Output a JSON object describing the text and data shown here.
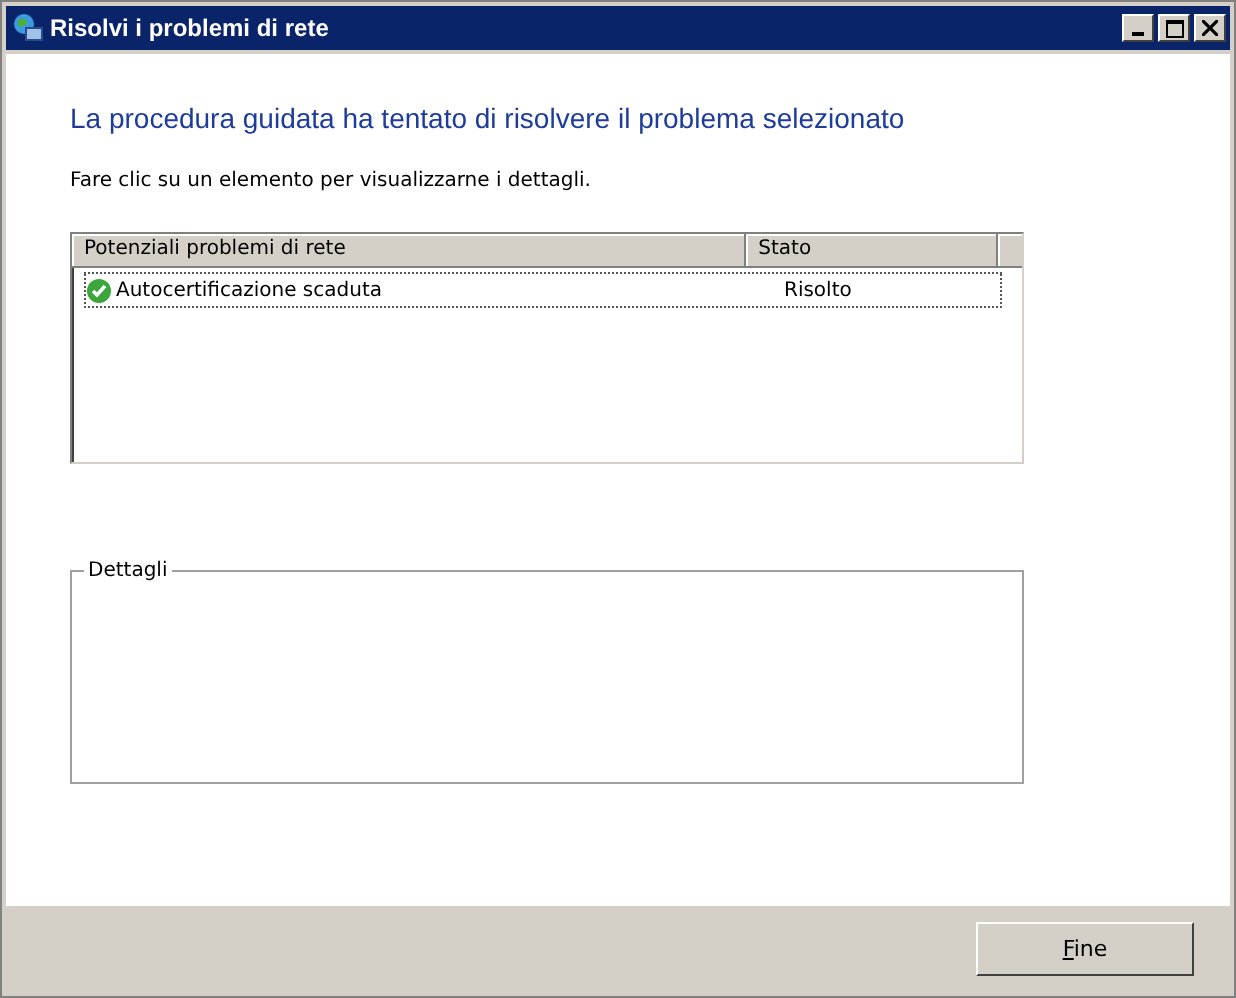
{
  "window": {
    "title": "Risolvi i problemi di rete"
  },
  "heading": "La procedura guidata ha tentato di risolvere il problema selezionato",
  "instruction": "Fare clic su un elemento per visualizzarne i dettagli.",
  "table": {
    "columns": [
      "Potenziali problemi di rete",
      "Stato"
    ],
    "rows": [
      {
        "name": "Autocertificazione scaduta",
        "status": "Risolto",
        "kind": "resolved",
        "selected": true
      }
    ]
  },
  "details": {
    "label": "Dettagli"
  },
  "buttons": [
    "Fine"
  ]
}
